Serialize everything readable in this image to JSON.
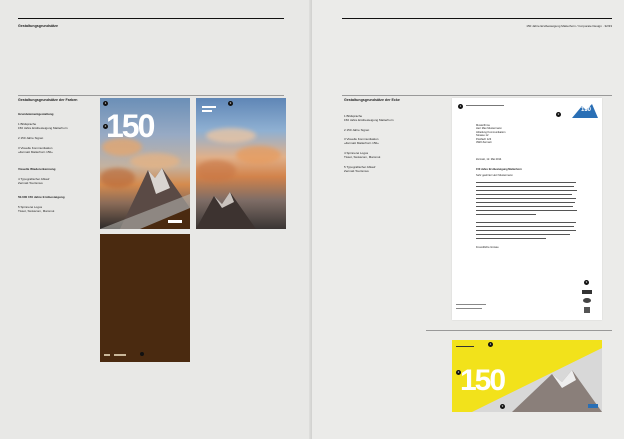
{
  "left_page": {
    "header_title": "Gestaltungsgrundsätze",
    "section_title": "Gestaltungsgrundsätze der Farben",
    "subsection_title": "Grundelementgestaltung",
    "items": [
      {
        "label": "1 Bildsprache",
        "sub": "150 Jahre Erstbesteigung Matterhorn"
      },
      {
        "label": "2 150 Jahre Signet",
        "sub": ""
      },
      {
        "label": "3 Visuelle Kommunikation",
        "sub": "»Zermatt Matterhorn 150«"
      }
    ],
    "group_title": "Visuelle Wiedererkennung",
    "group_items": [
      {
        "label": "4 Typografischer Ablauf",
        "sub": "Zermatt Tourismus"
      },
      {
        "label": "5 Spinnerei Logos",
        "sub": "Tissot, Swisscom, Mammut"
      }
    ],
    "note": "50.000 150 Jahre Erstbesteigung",
    "poster_number": "150"
  },
  "right_page": {
    "header_title": "150 Jahre Erstbesteigung Matterhorn / Corporate Design · 32/33",
    "section_title": "Gestaltungsgrundsätze der Ecke",
    "items": [
      {
        "label": "1 Bildsprache",
        "sub": "150 Jahre Erstbesteigung Matterhorn"
      },
      {
        "label": "2 150 Jahre Signet",
        "sub": ""
      },
      {
        "label": "3 Visuelle Kommunikation",
        "sub": "»Zermatt Matterhorn 150«"
      },
      {
        "label": "4 Spinnerei Logos",
        "sub": "Tissot, Swisscom, Mammut"
      },
      {
        "label": "5 Typografischer Ablauf",
        "sub": "Zermatt Tourismus"
      }
    ],
    "letter": {
      "recipient": [
        "Musterfirma",
        "Herr Max Mustermann",
        "Abteilung Kommunikation",
        "Strasse 12",
        "Postfach 123",
        "3920 Zermatt"
      ],
      "date": "Zermatt, 12. Mai 2014",
      "subject": "150 Jahre Erstbesteigung Matterhorn",
      "salutation": "Sehr geehrter Herr Mustermann",
      "closing": "Freundliche Grüsse"
    },
    "ticket_number": "150"
  },
  "colors": {
    "poster_brown": "#4a2a10",
    "ticket_yellow": "#f2e21b",
    "accent_blue": "#2a6fb5"
  }
}
